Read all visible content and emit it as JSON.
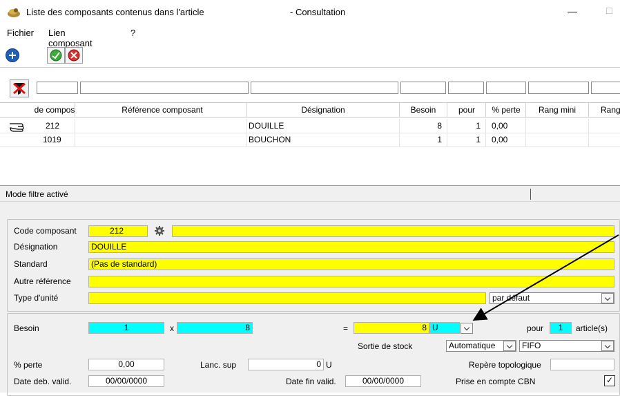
{
  "window": {
    "title_left": "Liste des composants contenus dans l'article",
    "title_right": "- Consultation",
    "minimize_glyph": "—",
    "maximize_glyph": "□"
  },
  "menu": [
    "Fichier",
    "Lien composant",
    "?"
  ],
  "grid": {
    "columns": [
      "de compos",
      "Référence composant",
      "Désignation",
      "Besoin",
      "pour",
      "% perte",
      "Rang mini",
      "Rang"
    ],
    "rows": [
      {
        "code": "212",
        "reference": "",
        "designation": "DOUILLE",
        "besoin": "8",
        "pour": "1",
        "perte": "0,00"
      },
      {
        "code": "1019",
        "reference": "",
        "designation": "BOUCHON",
        "besoin": "1",
        "pour": "1",
        "perte": "0,00"
      }
    ]
  },
  "status": "Mode filtre activé",
  "form": {
    "code_label": "Code composant",
    "code_value": "212",
    "designation_label": "Désignation",
    "designation_value": "DOUILLE",
    "standard_label": "Standard",
    "standard_value": "(Pas de standard)",
    "autre_ref_label": "Autre référence",
    "autre_ref_value": "",
    "type_unite_label": "Type d'unité",
    "type_unite_value": "",
    "type_unite_select": "par défaut",
    "besoin_label": "Besoin",
    "besoin_qty": "1",
    "times": "x",
    "besoin_factor": "8",
    "equals": "=",
    "besoin_result": "8",
    "unit": "U",
    "pour_label": "pour",
    "pour_value": "1",
    "articles_label": "article(s)",
    "sortie_label": "Sortie de stock",
    "sortie_value": "Automatique",
    "sortie_method": "FIFO",
    "perte_label": "% perte",
    "perte_value": "0,00",
    "lanc_label": "Lanc. sup",
    "lanc_value": "0",
    "lanc_unit": "U",
    "repere_label": "Repère topologique",
    "repere_value": "",
    "date_deb_label": "Date deb. valid.",
    "date_deb_value": "00/00/0000",
    "date_fin_label": "Date fin valid.",
    "date_fin_value": "00/00/0000",
    "cbn_label": "Prise en compte CBN",
    "cbn_check": "✓"
  },
  "colors": {
    "yellow": "#ffff00",
    "cyan": "#00ffff",
    "panel": "#f0f0f0"
  },
  "icons": {
    "app": "app-icon",
    "add": "add-icon",
    "validate": "validate-icon",
    "cancel": "cancel-icon",
    "clear_filter": "clear-filter-icon",
    "row_pointer": "pointing-hand-icon",
    "component_lookup": "gear-icon"
  }
}
